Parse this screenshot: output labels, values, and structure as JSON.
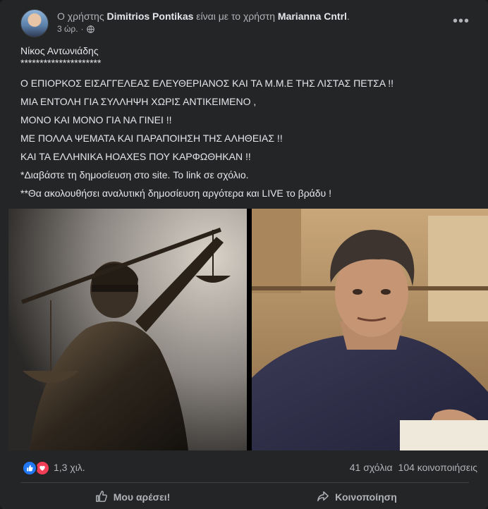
{
  "post": {
    "header": {
      "prefix": "Ο χρήστης",
      "author": "Dimitrios Pontikas",
      "middle": "είναι με το χρήστη",
      "tagged": "Marianna Cntrl",
      "suffix": ".",
      "time": "3 ώρ.",
      "separator": "·"
    },
    "text": {
      "name": "Νίκος Αντωνιάδης",
      "stars": "*********************",
      "line1": "Ο ΕΠΙΟΡΚΟΣ ΕΙΣΑΓΓΕΛΕΑΣ ΕΛΕΥΘΕΡΙΑΝΟΣ ΚΑΙ ΤΑ Μ.Μ.Ε ΤΗΣ ΛΙΣΤΑΣ ΠΕΤΣΑ !!",
      "line2": "ΜΙΑ ΕΝΤΟΛΗ ΓΙΑ ΣΥΛΛΗΨΗ ΧΩΡΙΣ ΑΝΤΙΚΕΙΜΕΝΟ ,",
      "line3": "ΜΟΝΟ ΚΑΙ ΜΟΝΟ ΓΙΑ ΝΑ ΓΙΝΕΙ !!",
      "line4": "ΜΕ ΠΟΛΛΑ ΨΕΜΑΤΑ ΚΑΙ ΠΑΡΑΠΟΙΗΣΗ ΤΗΣ ΑΛΗΘΕΙΑΣ !!",
      "line5": "ΚΑΙ ΤΑ ΕΛΛΗΝΙΚΑ ΗΟΑΧΕS ΠΟΥ ΚΑΡΦΩΘΗΚΑΝ !!",
      "line6": "*Διαβάστε τη δημοσίευση στο site. Το link σε σχόλιο.",
      "line7": "**Θα ακολουθήσει αναλυτική δημοσίευση αργότερα και LIVE το βράδυ !"
    },
    "stats": {
      "reactions": "1,3 χιλ.",
      "comments": "41 σχόλια",
      "shares": "104 κοινοποιήσεις"
    },
    "actions": {
      "like": "Μου αρέσει!",
      "share": "Κοινοποίηση"
    }
  },
  "colors": {
    "background": "#242526",
    "text": "#e4e6eb",
    "secondary": "#b0b3b8",
    "like_blue": "#2078f4",
    "love_red": "#f33e58"
  },
  "icons": [
    "globe-icon",
    "more-options-icon",
    "like-reaction-icon",
    "love-reaction-icon",
    "thumbs-up-icon",
    "share-arrow-icon"
  ]
}
